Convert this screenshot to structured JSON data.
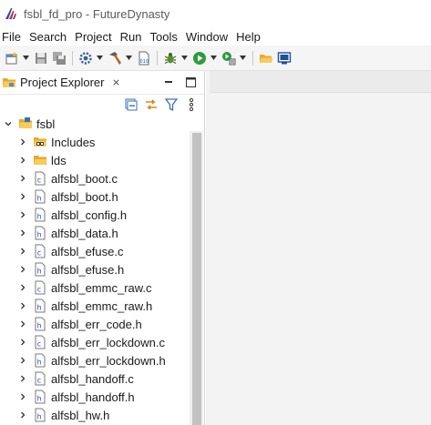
{
  "window": {
    "title": "fsbl_fd_pro - FutureDynasty",
    "logo_icon": "futuredynasty-logo-icon"
  },
  "menubar": {
    "items": [
      {
        "label": "File"
      },
      {
        "label": "Search"
      },
      {
        "label": "Project"
      },
      {
        "label": "Run"
      },
      {
        "label": "Tools"
      },
      {
        "label": "Window"
      },
      {
        "label": "Help"
      }
    ]
  },
  "toolbar": {
    "buttons": [
      {
        "icon": "new-icon",
        "dropdown": true
      },
      {
        "icon": "save-icon"
      },
      {
        "icon": "save-all-icon"
      },
      {
        "icon": "settings-gear-icon",
        "dropdown": true
      },
      {
        "icon": "build-hammer-icon",
        "dropdown": true
      },
      {
        "icon": "binary-file-icon"
      },
      {
        "icon": "debug-bug-icon",
        "dropdown": true
      },
      {
        "icon": "run-icon",
        "dropdown": true
      },
      {
        "icon": "external-tools-icon",
        "dropdown": true
      },
      {
        "icon": "open-folder-icon"
      },
      {
        "icon": "terminal-icon"
      }
    ]
  },
  "project_explorer": {
    "tab_label": "Project Explorer",
    "close_glyph": "⨯",
    "tree": {
      "root": {
        "label": "fsbl",
        "expanded": true
      },
      "children": [
        {
          "label": "Includes",
          "type": "includes"
        },
        {
          "label": "lds",
          "type": "folder"
        },
        {
          "label": "alfsbl_boot.c",
          "type": "c"
        },
        {
          "label": "alfsbl_boot.h",
          "type": "h"
        },
        {
          "label": "alfsbl_config.h",
          "type": "h"
        },
        {
          "label": "alfsbl_data.h",
          "type": "h"
        },
        {
          "label": "alfsbl_efuse.c",
          "type": "c"
        },
        {
          "label": "alfsbl_efuse.h",
          "type": "h"
        },
        {
          "label": "alfsbl_emmc_raw.c",
          "type": "c"
        },
        {
          "label": "alfsbl_emmc_raw.h",
          "type": "h"
        },
        {
          "label": "alfsbl_err_code.h",
          "type": "h"
        },
        {
          "label": "alfsbl_err_lockdown.c",
          "type": "c"
        },
        {
          "label": "alfsbl_err_lockdown.h",
          "type": "h"
        },
        {
          "label": "alfsbl_handoff.c",
          "type": "c"
        },
        {
          "label": "alfsbl_handoff.h",
          "type": "h"
        },
        {
          "label": "alfsbl_hw.h",
          "type": "h"
        }
      ]
    }
  }
}
